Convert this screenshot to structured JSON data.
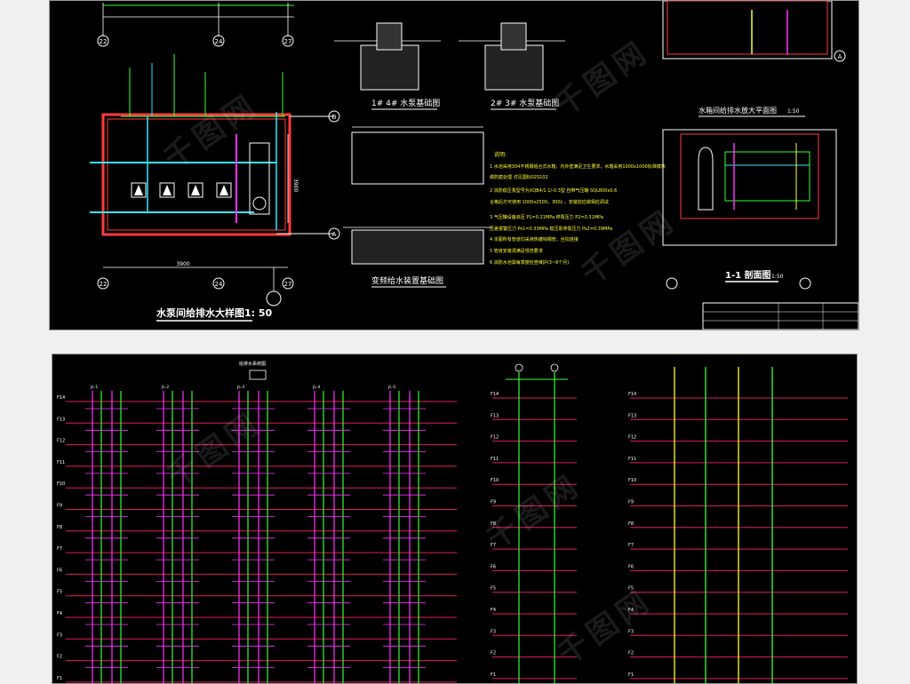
{
  "top_sheet": {
    "pump_room_plan_title": "水泵间给排水大样图1: 50",
    "foundation_1_title": "1# 4# 水泵基础图",
    "foundation_2_title": "2# 3# 水泵基础图",
    "variable_freq_title": "变频给水装置基础图",
    "tank_plan_title": "水箱间给排水放大平面图",
    "tank_plan_scale": "1:50",
    "section_title": "1-1 剖面图",
    "section_scale": "1:50",
    "axis_labels": [
      "22",
      "24",
      "27",
      "B",
      "A",
      "22",
      "24",
      "27",
      "A"
    ],
    "dimension_3900": "3900",
    "dimension_2600": "2600",
    "notes_heading": "说明:",
    "notes": [
      "1  水池采用304不锈钢组合式水箱，内外壁满足卫生要求，水箱采用1000x1000标准模块",
      "   做防腐处理   详见国标02S102",
      "2  消防稳压泵型号为XQB4/1.1/-0.3型  自带气压罐 SQL800x0.6",
      "   合格后方可使用 1000x2500，300L 。安装前应做相应调试",
      "3  气压罐设备启压   P1=0.21MPa  停泵压力 P2=0.31MPa",
      "   压差报警压力 Ps1=0.33MPa  稳压泵停泵压力 Ps2=0.39MPa",
      "4  本图所有管道均采用热镀锌钢管，丝扣连接",
      "5  管道安装须满足规范要求",
      "6  消防水池需每季度检查维护(3~6个月)"
    ]
  },
  "bottom_sheet": {
    "system_title": "给排水系统图",
    "floor_labels": [
      "F14",
      "F13",
      "F12",
      "F11",
      "F10",
      "F9",
      "F8",
      "F7",
      "F6",
      "F5",
      "F4",
      "F3",
      "F2",
      "F1"
    ],
    "riser_tags": [
      "JL-1",
      "JL-2",
      "JL-3",
      "JL-4",
      "JL-5"
    ]
  },
  "watermark": "千图网",
  "colors": {
    "floor_line": "#e01e5a",
    "riser_magenta": "#ff33ff",
    "riser_green": "#33ff33",
    "text_white": "#ffffff",
    "text_yellow": "#ffff33",
    "wall_red": "#ff3b3b",
    "accent_cyan": "#33e6ff"
  }
}
